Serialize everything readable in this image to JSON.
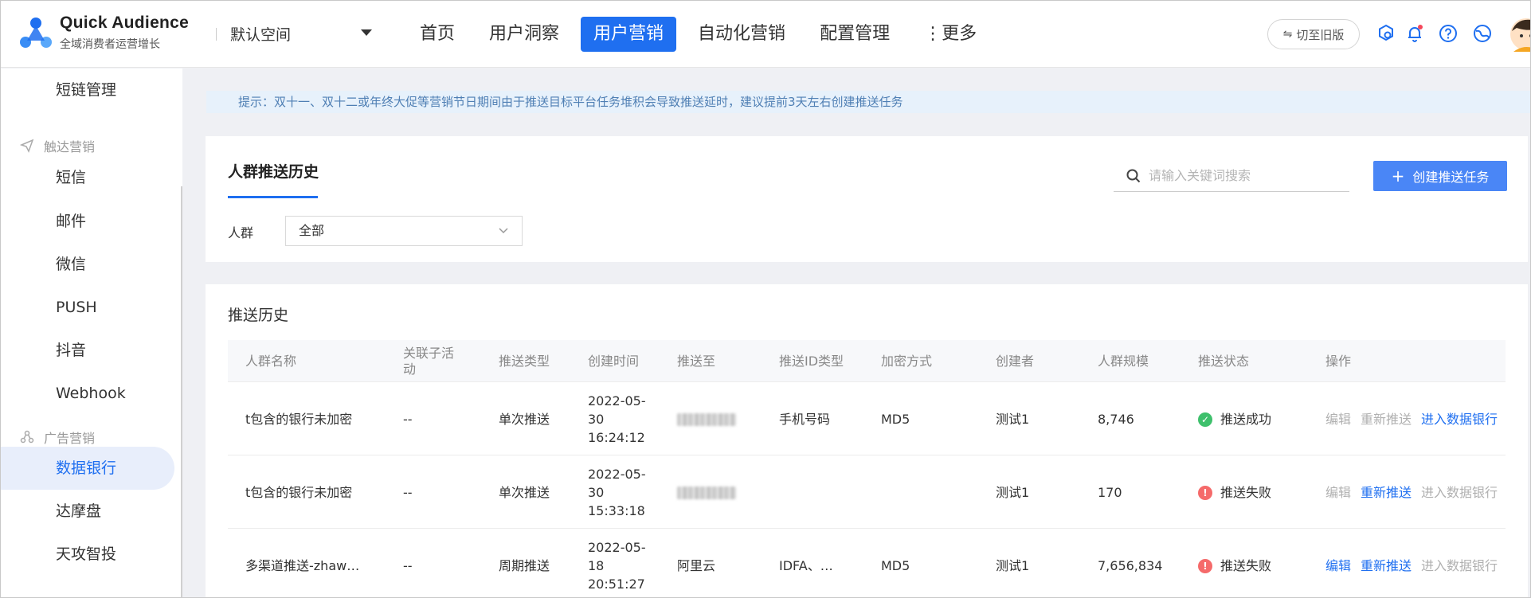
{
  "header": {
    "brand_title": "Quick Audience",
    "brand_sub": "全域消费者运营增长",
    "space": "默认空间",
    "nav": [
      {
        "label": "首页",
        "active": false
      },
      {
        "label": "用户洞察",
        "active": false
      },
      {
        "label": "用户营销",
        "active": true
      },
      {
        "label": "自动化营销",
        "active": false
      },
      {
        "label": "配置管理",
        "active": false
      },
      {
        "label": "⋮更多",
        "active": false
      }
    ],
    "switch_label": "切至旧版"
  },
  "sidebar": {
    "items": [
      {
        "label": "短链管理"
      },
      {
        "group": "触达营销"
      },
      {
        "label": "短信"
      },
      {
        "label": "邮件"
      },
      {
        "label": "微信"
      },
      {
        "label": "PUSH"
      },
      {
        "label": "抖音"
      },
      {
        "label": "Webhook"
      },
      {
        "group": "广告营销"
      },
      {
        "label": "数据银行",
        "active": true
      },
      {
        "label": "达摩盘"
      },
      {
        "label": "天攻智投"
      }
    ]
  },
  "tip": "提示：双十一、双十二或年终大促等营销节日期间由于推送目标平台任务堆积会导致推送延时，建议提前3天左右创建推送任务",
  "card1": {
    "tab": "人群推送历史",
    "search_placeholder": "请输入关键词搜索",
    "create_label": "创建推送任务",
    "filter_label": "人群",
    "filter_value": "全部"
  },
  "card2": {
    "title": "推送历史",
    "columns": [
      "人群名称",
      "关联子活动",
      "推送类型",
      "创建时间",
      "推送至",
      "推送ID类型",
      "加密方式",
      "创建者",
      "人群规模",
      "推送状态",
      "操作"
    ],
    "rows": [
      {
        "name": "t包含的银行未加密",
        "sub": "--",
        "type": "单次推送",
        "time": [
          "2022-05-",
          "30",
          "16:24:12"
        ],
        "target": "",
        "id_type": "手机号码",
        "encrypt": "MD5",
        "creator": "测试1",
        "size": "8,746",
        "status": "推送成功",
        "status_kind": "ok",
        "ops": [
          {
            "label": "编辑",
            "enabled": false
          },
          {
            "label": "重新推送",
            "enabled": false
          },
          {
            "label": "进入数据银行",
            "enabled": true
          }
        ]
      },
      {
        "name": "t包含的银行未加密",
        "sub": "--",
        "type": "单次推送",
        "time": [
          "2022-05-",
          "30",
          "15:33:18"
        ],
        "target": "",
        "id_type": "",
        "encrypt": "",
        "creator": "测试1",
        "size": "170",
        "status": "推送失败",
        "status_kind": "err",
        "ops": [
          {
            "label": "编辑",
            "enabled": false
          },
          {
            "label": "重新推送",
            "enabled": true
          },
          {
            "label": "进入数据银行",
            "enabled": false
          }
        ]
      },
      {
        "name": "多渠道推送-zhaw…",
        "sub": "--",
        "type": "周期推送",
        "time": [
          "2022-05-",
          "18",
          "20:51:27"
        ],
        "target": "阿里云",
        "id_type": "IDFA、…",
        "encrypt": "MD5",
        "creator": "测试1",
        "size": "7,656,834",
        "status": "推送失败",
        "status_kind": "err",
        "ops": [
          {
            "label": "编辑",
            "enabled": true
          },
          {
            "label": "重新推送",
            "enabled": true
          },
          {
            "label": "进入数据银行",
            "enabled": false
          }
        ]
      }
    ]
  }
}
